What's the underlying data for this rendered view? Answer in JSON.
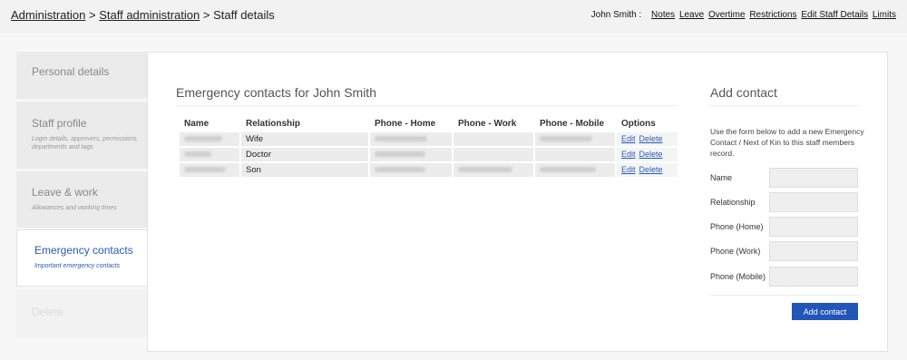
{
  "breadcrumb": {
    "administration": "Administration",
    "sep1": " > ",
    "staff_administration": "Staff administration",
    "sep2": " > ",
    "current": "Staff details"
  },
  "topnav": {
    "user": "John Smith :",
    "links": [
      "Notes",
      "Leave",
      "Overtime",
      "Restrictions",
      "Edit Staff Details",
      "Limits"
    ]
  },
  "sidebar": {
    "items": [
      {
        "title": "Personal details",
        "subtitle": ""
      },
      {
        "title": "Staff profile",
        "subtitle": "Login details, approvers, permissions, departments and tags"
      },
      {
        "title": "Leave & work",
        "subtitle": "Allowances and working times"
      },
      {
        "title": "Emergency contacts",
        "subtitle": "Important emergency contacts"
      },
      {
        "title": "Delete",
        "subtitle": ""
      }
    ]
  },
  "contacts": {
    "title": "Emergency contacts for John Smith",
    "columns": [
      "Name",
      "Relationship",
      "Phone - Home",
      "Phone - Work",
      "Phone - Mobile",
      "Options"
    ],
    "rows": [
      {
        "relationship": "Wife"
      },
      {
        "relationship": "Doctor"
      },
      {
        "relationship": "Son"
      }
    ],
    "edit_label": "Edit",
    "delete_label": "Delete"
  },
  "add_contact": {
    "title": "Add contact",
    "intro": "Use the form below to add a new Emergency Contact / Next of Kin to this staff members record.",
    "fields": [
      "Name",
      "Relationship",
      "Phone (Home)",
      "Phone (Work)",
      "Phone (Mobile)"
    ],
    "submit_label": "Add contact"
  },
  "colors": {
    "accent": "#2255b8",
    "link": "#2a5bb5"
  }
}
